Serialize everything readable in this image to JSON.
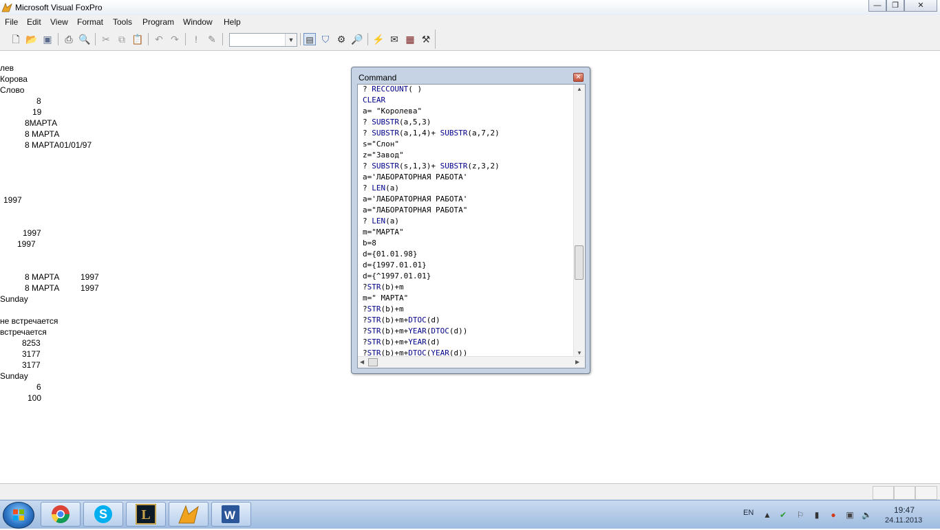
{
  "app": {
    "title": "Microsoft Visual FoxPro"
  },
  "window_controls": {
    "minimize": "—",
    "restore": "❐",
    "close": "✕"
  },
  "menu": [
    "File",
    "Edit",
    "View",
    "Format",
    "Tools",
    "Program",
    "Window",
    "Help"
  ],
  "toolbar": {
    "combo_value": "",
    "icons": [
      "new-icon",
      "open-icon",
      "save-icon",
      "print-icon",
      "print-preview-icon",
      "cut-icon",
      "copy-icon",
      "paste-icon",
      "undo-icon",
      "redo-icon",
      "run-icon",
      "modify-form-icon",
      "command-window-icon",
      "view-window-icon",
      "properties-window-icon",
      "class-browser-icon",
      "component-gallery-icon",
      "form-wizard-icon",
      "report-icon",
      "tools-icon"
    ]
  },
  "output_lines": [
    "лев",
    "Корова",
    "Слово",
    "8",
    "19",
    "8МАРТА",
    "8 МАРТА",
    "8 МАРТА01/01/97",
    "1997",
    "1997",
    "1997",
    "8 МАРТА",
    "1997",
    "8 МАРТА",
    "1997",
    "Sunday",
    "не встречается",
    "встречается",
    "8253",
    "3177",
    "3177",
    "Sunday",
    "6",
    "100"
  ],
  "command_window": {
    "title": "Command",
    "close_label": "✕",
    "code": [
      {
        "pre": "? ",
        "kw": "RECCOUNT",
        "post": "( )"
      },
      {
        "pre": "",
        "kw": "CLEAR",
        "post": ""
      },
      {
        "pre": "a= \"Королева\"",
        "kw": "",
        "post": ""
      },
      {
        "pre": "? ",
        "kw": "SUBSTR",
        "post": "(a,5,3)"
      },
      {
        "pre": "? ",
        "kw": "SUBSTR",
        "post": "(a,1,4)+ ",
        "kw2": "SUBSTR",
        "post2": "(a,7,2)"
      },
      {
        "pre": "s=\"Слон\"",
        "kw": "",
        "post": ""
      },
      {
        "pre": "z=\"Завод\"",
        "kw": "",
        "post": ""
      },
      {
        "pre": "? ",
        "kw": "SUBSTR",
        "post": "(s,1,3)+ ",
        "kw2": "SUBSTR",
        "post2": "(z,3,2)"
      },
      {
        "pre": "a='ЛАБОРАТОРНАЯ РАБОТА'",
        "kw": "",
        "post": ""
      },
      {
        "pre": "? ",
        "kw": "LEN",
        "post": "(a)"
      },
      {
        "pre": "a='ЛАБОРАТОРНАЯ РАБОТА'",
        "kw": "",
        "post": ""
      },
      {
        "pre": "a=\"ЛАБОРАТОРНАЯ РАБОТА\"",
        "kw": "",
        "post": ""
      },
      {
        "pre": "? ",
        "kw": "LEN",
        "post": "(a)"
      },
      {
        "pre": "m=\"МАРТА\"",
        "kw": "",
        "post": ""
      },
      {
        "pre": "b=8",
        "kw": "",
        "post": ""
      },
      {
        "pre": "d={01.01.98}",
        "kw": "",
        "post": ""
      },
      {
        "pre": "d={1997.01.01}",
        "kw": "",
        "post": ""
      },
      {
        "pre": "d={^1997.01.01}",
        "kw": "",
        "post": ""
      },
      {
        "pre": "?",
        "kw": "STR",
        "post": "(b)+m"
      },
      {
        "pre": "m=\" МАРТА\"",
        "kw": "",
        "post": ""
      },
      {
        "pre": "?",
        "kw": "STR",
        "post": "(b)+m"
      },
      {
        "pre": "?",
        "kw": "STR",
        "post": "(b)+m+",
        "kw2": "DTOC",
        "post2": "(d)"
      },
      {
        "pre": "?",
        "kw": "STR",
        "post": "(b)+m+",
        "kw2": "YEAR",
        "post2": "(",
        "kw3": "DTOC",
        "post3": "(d))"
      },
      {
        "pre": "?",
        "kw": "STR",
        "post": "(b)+m+",
        "kw2": "YEAR",
        "post2": "(d)"
      },
      {
        "pre": "?",
        "kw": "STR",
        "post": "(b)+m+",
        "kw2": "DTOC",
        "post2": "(",
        "kw3": "YEAR",
        "post3": "(d))"
      }
    ]
  },
  "taskbar": {
    "apps": [
      "chrome-icon",
      "skype-icon",
      "league-of-legends-icon",
      "visual-foxpro-icon",
      "word-icon"
    ],
    "language": "EN",
    "time": "19:47",
    "date": "24.11.2013"
  }
}
